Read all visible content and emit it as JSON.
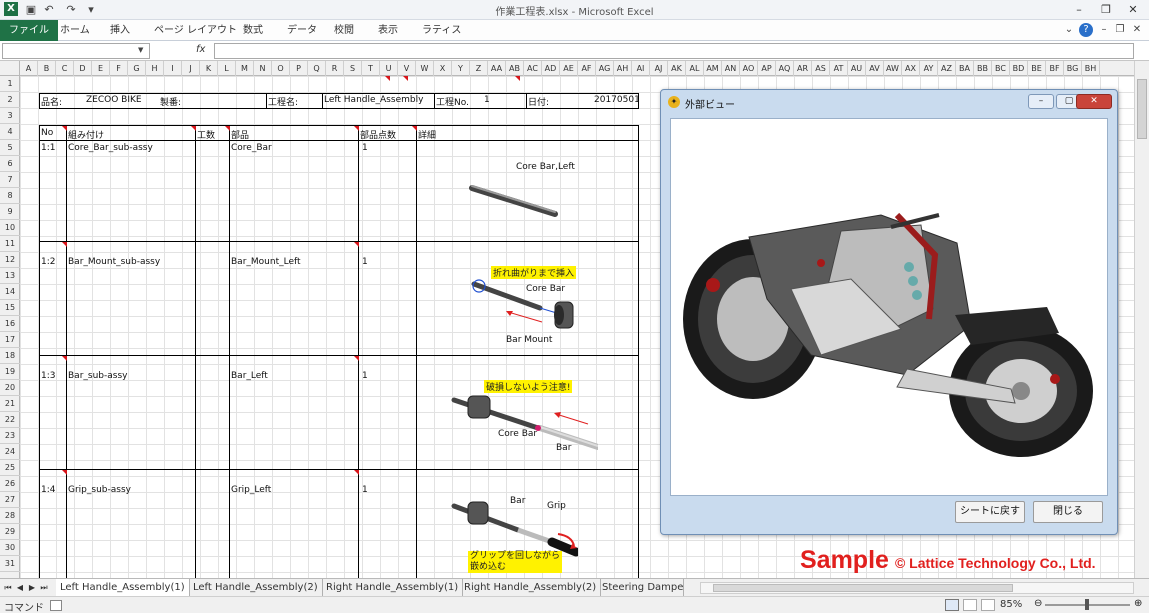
{
  "window": {
    "title": "作業工程表.xlsx  -  Microsoft Excel",
    "app_icon": "excel-icon"
  },
  "ribbon": {
    "tabs": [
      "ファイル",
      "ホーム",
      "挿入",
      "ページ レイアウト",
      "数式",
      "データ",
      "校閲",
      "表示",
      "ラティス"
    ]
  },
  "formula_bar": {
    "name_box": "",
    "fx": "fx",
    "formula": ""
  },
  "columns": [
    "A",
    "B",
    "C",
    "D",
    "E",
    "F",
    "G",
    "H",
    "I",
    "J",
    "K",
    "L",
    "M",
    "N",
    "O",
    "P",
    "Q",
    "R",
    "S",
    "T",
    "U",
    "V",
    "W",
    "X",
    "Y",
    "Z",
    "AA",
    "AB",
    "AC",
    "AD",
    "AE",
    "AF",
    "AG",
    "AH",
    "AI",
    "AJ",
    "AK",
    "AL",
    "AM",
    "AN",
    "AO",
    "AP",
    "AQ",
    "AR",
    "AS",
    "AT",
    "AU",
    "AV",
    "AW",
    "AX",
    "AY",
    "AZ",
    "BA",
    "BB",
    "BC",
    "BD",
    "BE",
    "BF",
    "BG",
    "BH"
  ],
  "rows": [
    "1",
    "2",
    "3",
    "4",
    "5",
    "6",
    "7",
    "8",
    "9",
    "10",
    "11",
    "12",
    "13",
    "14",
    "15",
    "16",
    "17",
    "18",
    "19",
    "20",
    "21",
    "22",
    "23",
    "24",
    "25",
    "26",
    "27",
    "28",
    "29",
    "30",
    "31"
  ],
  "sheet": {
    "header": {
      "product_label": "品名:",
      "product_value": "ZECOO BIKE",
      "number_label": "製番:",
      "process_label": "工程名:",
      "process_value": "Left Handle_Assembly",
      "process_no_label": "工程No.",
      "process_no_value": "1",
      "date_label": "日付:",
      "date_value": "20170501"
    },
    "columns": {
      "no": "No",
      "assembly": "組み付け",
      "man_hours": "工数",
      "part": "部品",
      "part_count": "部品点数",
      "detail": "詳細"
    },
    "steps": [
      {
        "no": "1:1",
        "assembly": "Core_Bar_sub-assy",
        "part": "Core_Bar",
        "count": "1"
      },
      {
        "no": "1:2",
        "assembly": "Bar_Mount_sub-assy",
        "part": "Bar_Mount_Left",
        "count": "1"
      },
      {
        "no": "1:3",
        "assembly": "Bar_sub-assy",
        "part": "Bar_Left",
        "count": "1"
      },
      {
        "no": "1:4",
        "assembly": "Grip_sub-assy",
        "part": "Grip_Left",
        "count": "1"
      }
    ],
    "drawings": {
      "d1_label": "Core Bar,Left",
      "d2_callout": "折れ曲がりまで挿入",
      "d2_label1": "Core Bar",
      "d2_label2": "Bar Mount",
      "d3_callout": "破損しないよう注意!",
      "d3_label1": "Core Bar",
      "d3_label2": "Bar",
      "d4_label1": "Bar",
      "d4_label2": "Grip",
      "d4_callout_line1": "グリップを回しながら",
      "d4_callout_line2": "嵌め込む"
    }
  },
  "sheet_tabs": [
    "Left Handle_Assembly(1)",
    "Left Handle_Assembly(2)",
    "Right Handle_Assembly(1)",
    "Right Handle_Assembly(2)",
    "Steering Dampe"
  ],
  "status": {
    "mode": "コマンド",
    "zoom": "85%"
  },
  "popup": {
    "title": "外部ビュー",
    "button_back": "シートに戻す",
    "button_close": "閉じる"
  },
  "watermark": {
    "big": "Sample",
    "small": "© Lattice Technology Co., Ltd."
  }
}
